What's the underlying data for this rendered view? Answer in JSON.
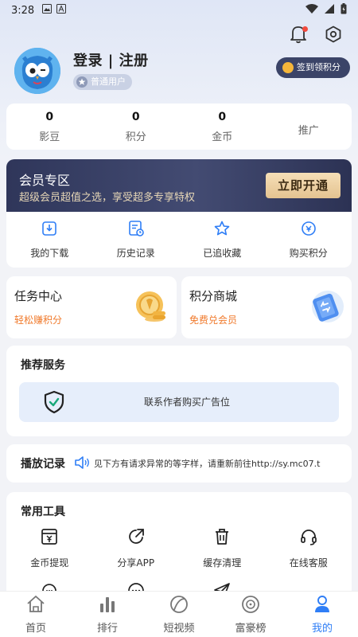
{
  "status_bar": {
    "time": "3:28"
  },
  "profile": {
    "login_text": "登录 | 注册",
    "user_level": "普通用户",
    "signin_label": "签到领积分"
  },
  "stats": [
    {
      "value": "0",
      "label": "影豆"
    },
    {
      "value": "0",
      "label": "积分"
    },
    {
      "value": "0",
      "label": "金币"
    },
    {
      "value": "",
      "label": "推广"
    }
  ],
  "vip": {
    "title": "会员专区",
    "subtitle": "超级会员超值之选，享受超多专享特权",
    "button": "立即开通"
  },
  "quick_actions": [
    {
      "label": "我的下载",
      "icon": "download-icon"
    },
    {
      "label": "历史记录",
      "icon": "history-icon"
    },
    {
      "label": "已追收藏",
      "icon": "star-icon"
    },
    {
      "label": "购买积分",
      "icon": "points-icon"
    }
  ],
  "task_center": {
    "title": "任务中心",
    "subtitle": "轻松赚积分"
  },
  "points_mall": {
    "title": "积分商城",
    "subtitle": "免费兑会员"
  },
  "recommend": {
    "title": "推荐服务",
    "ad_text": "联系作者购买广告位"
  },
  "play_record": {
    "title": "播放记录",
    "marquee": "见下方有请求异常的等字样，请重新前往http://sy.mc07.t"
  },
  "tools": {
    "title": "常用工具",
    "items": [
      {
        "label": "金币提现",
        "icon": "withdraw-icon"
      },
      {
        "label": "分享APP",
        "icon": "share-icon"
      },
      {
        "label": "缓存清理",
        "icon": "trash-icon"
      },
      {
        "label": "在线客服",
        "icon": "headset-icon"
      }
    ]
  },
  "tabbar": [
    {
      "label": "首页",
      "icon": "home-icon"
    },
    {
      "label": "排行",
      "icon": "rank-icon"
    },
    {
      "label": "短视频",
      "icon": "short-video-icon"
    },
    {
      "label": "富豪榜",
      "icon": "rich-list-icon"
    },
    {
      "label": "我的",
      "icon": "profile-icon",
      "active": true
    }
  ],
  "colors": {
    "accent": "#2f7ef6",
    "vip_bg": "#3b4468",
    "task_orange": "#f07a2c"
  }
}
